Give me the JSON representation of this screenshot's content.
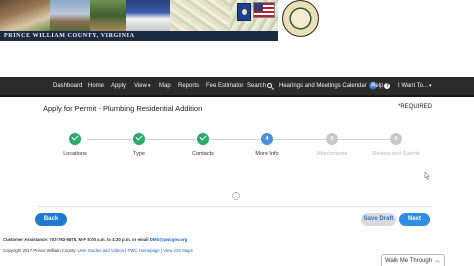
{
  "banner": {
    "county_name": "PRINCE WILLIAM COUNTY, VIRGINIA"
  },
  "nav": {
    "items": [
      {
        "label": "Dashboard"
      },
      {
        "label": "Home"
      },
      {
        "label": "Apply"
      },
      {
        "label": "View"
      },
      {
        "label": "Map"
      },
      {
        "label": "Reports"
      },
      {
        "label": "Fee Estimator"
      },
      {
        "label": "Search"
      },
      {
        "label": "Hearings and Meetings Calendar"
      },
      {
        "label": "Help"
      },
      {
        "label": "I Want To..."
      }
    ],
    "calendar_badge": "0"
  },
  "page": {
    "title": "Apply for Permit - Plumbing Residential Addition",
    "required_note": "*REQUIRED"
  },
  "stepper": {
    "steps": [
      {
        "label": "Locations",
        "state": "done",
        "number": ""
      },
      {
        "label": "Type",
        "state": "done",
        "number": ""
      },
      {
        "label": "Contacts",
        "state": "done",
        "number": ""
      },
      {
        "label": "More Info",
        "state": "active",
        "number": "4"
      },
      {
        "label": "Attachments",
        "state": "pending",
        "number": "5"
      },
      {
        "label": "Review and Submit",
        "state": "pending",
        "number": "6"
      }
    ]
  },
  "actions": {
    "back_label": "Back",
    "save_draft_label": "Save Draft",
    "next_label": "Next"
  },
  "footer": {
    "assistance_prefix": "Customer Assistance: 703-792-6875, M-F 8:00 a.m. to 4:30 p.m. or email ",
    "assistance_email": "DMS@pwcgov.org",
    "copyright_prefix": "Copyright 2017 Prince William County. ",
    "link_user_guides": "User Guides and Videos",
    "separator_1": " | ",
    "link_pwc_homepage": "PWC Homepage",
    "separator_2": " | ",
    "link_gis_maps": "View GIS Maps"
  },
  "walkthrough": {
    "label": "Walk Me Through"
  },
  "colors": {
    "nav_background": "#2b2b2b",
    "step_done": "#2aa86a",
    "step_active": "#4d8dd9",
    "step_pending": "#c9c9c9",
    "primary_button": "#1f79d0",
    "link": "#1f62c6"
  },
  "icons": {
    "search": "search-icon",
    "help": "help-icon",
    "check": "check-icon",
    "spinner": "loading-spinner-icon",
    "chevron": "chevron-up-icon"
  }
}
